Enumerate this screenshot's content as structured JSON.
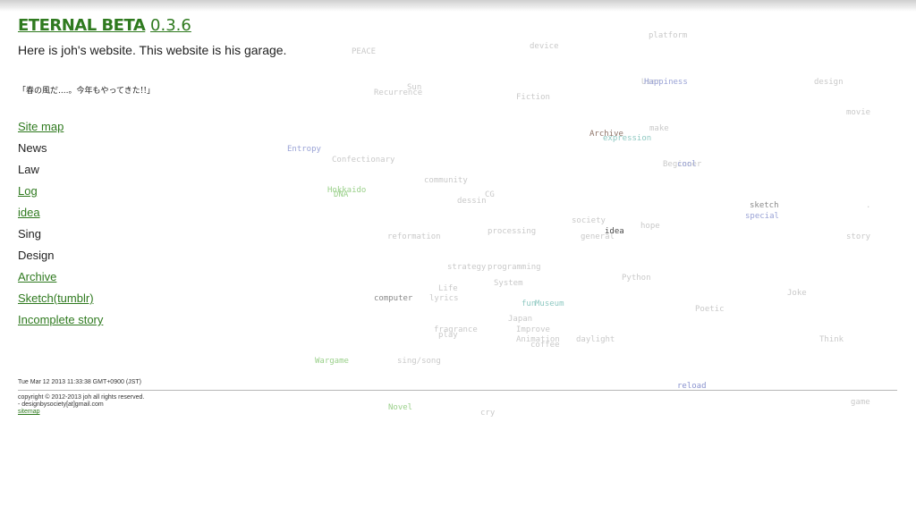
{
  "header": {
    "title_name": "ETERNAL BETA",
    "title_version": "0.3.6",
    "tagline": "Here is joh's website. This website is his garage.",
    "quote": "「春の風だ....。今年もやってきた!!」"
  },
  "nav": {
    "items": [
      {
        "label": "Site map"
      },
      {
        "label": "News"
      },
      {
        "label": "Law"
      },
      {
        "label": "Log"
      },
      {
        "label": "idea"
      },
      {
        "label": "Sing"
      },
      {
        "label": "Design"
      },
      {
        "label": "Archive"
      },
      {
        "label": "Sketch(tumblr)"
      },
      {
        "label": "Incomplete story"
      }
    ]
  },
  "cloud": {
    "words": [
      "platform",
      "device",
      "PEACE",
      "Sun",
      "Recurrence",
      "Fiction",
      "User",
      "Happiness",
      "design",
      "movie",
      "Archive",
      "expression",
      "make",
      "Entropy",
      "Confectionary",
      "Beginner",
      "cool",
      "community",
      "Hokkaido",
      "DNA",
      "CG",
      "dessin",
      "sketch",
      "special",
      "society",
      "hope",
      "reformation",
      "processing",
      "general",
      "idea",
      "story",
      "strategy",
      "programming",
      "Python",
      "System",
      "Life",
      "Joke",
      "computer",
      "lyrics",
      "fun",
      "Museum",
      "Poetic",
      "Japan",
      "fragrance",
      "play",
      "Improve",
      "Animation",
      "coffee",
      "daylight",
      "Think",
      "Wargame",
      "sing/song",
      "Novel",
      "cry",
      "game",
      "."
    ]
  },
  "footer": {
    "timestamp": "Tue Mar 12 2013 11:33:38 GMT+0900 (JST)",
    "reload": "reload",
    "copyright": "copyright © 2012-2013 joh all rights reserved.",
    "email": "- designbysociety[at]gmail.com",
    "sitemap": "sitemap"
  },
  "colors": {
    "accent": "#2f7a1f",
    "cloud_gray": "#c9c9c9",
    "cloud_blue": "#9aa3d6",
    "cloud_green": "#9ad08a"
  }
}
